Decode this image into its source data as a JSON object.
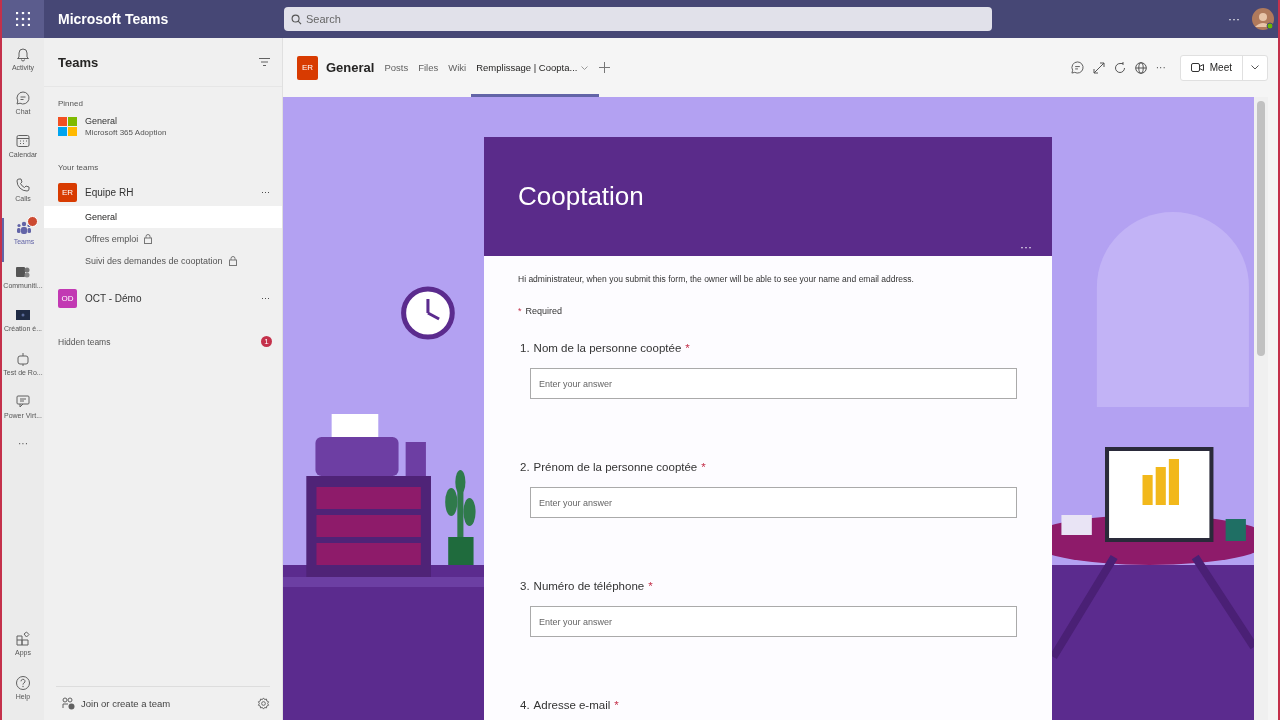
{
  "app_bar": {
    "title": "Microsoft Teams",
    "search_placeholder": "Search",
    "more": "···"
  },
  "rail": [
    {
      "label": "Activity",
      "selected": false,
      "badge": false
    },
    {
      "label": "Chat",
      "selected": false,
      "badge": false
    },
    {
      "label": "Calendar",
      "selected": false,
      "badge": false
    },
    {
      "label": "Calls",
      "selected": false,
      "badge": false
    },
    {
      "label": "Teams",
      "selected": true,
      "badge": true
    },
    {
      "label": "Communiti...",
      "selected": false,
      "badge": false
    },
    {
      "label": "Création é...",
      "selected": false,
      "badge": false
    },
    {
      "label": "Test de Ro...",
      "selected": false,
      "badge": false
    },
    {
      "label": "Power Virt...",
      "selected": false,
      "badge": false
    }
  ],
  "rail_more": "···",
  "rail_bottom": [
    {
      "label": "Apps"
    },
    {
      "label": "Help"
    }
  ],
  "sidebar": {
    "title": "Teams",
    "pinned_heading": "Pinned",
    "pinned": [
      {
        "name": "General",
        "team": "Microsoft 365 Adoption"
      }
    ],
    "teams_heading": "Your teams",
    "teams": [
      {
        "initials": "ER",
        "name": "Equipe RH",
        "color": "#d83b01",
        "more": "···",
        "channels": [
          {
            "name": "General",
            "selected": true,
            "private": false
          },
          {
            "name": "Offres emploi",
            "selected": false,
            "private": true
          },
          {
            "name": "Suivi des demandes de cooptation",
            "selected": false,
            "private": true
          }
        ]
      },
      {
        "initials": "OD",
        "name": "OCT - Démo",
        "color": "#c239b3",
        "more": "···"
      }
    ],
    "hidden_label": "Hidden teams",
    "hidden_count": "1",
    "footer": "Join or create a team"
  },
  "channel_header": {
    "initials": "ER",
    "name": "General",
    "tabs": [
      {
        "label": "Posts",
        "selected": false
      },
      {
        "label": "Files",
        "selected": false
      },
      {
        "label": "Wiki",
        "selected": false
      },
      {
        "label": "Remplissage | Coopta...",
        "selected": true
      }
    ],
    "more": "···",
    "meet": "Meet"
  },
  "form": {
    "title": "Cooptation",
    "menu": "···",
    "notice": "Hi administrateur, when you submit this form, the owner will be able to see your name and email address.",
    "required_mark": "*",
    "required_label": "Required",
    "questions": [
      {
        "number": "1.",
        "label": "Nom de la personne cooptée",
        "required": true,
        "placeholder": "Enter your answer"
      },
      {
        "number": "2.",
        "label": "Prénom de la personne cooptée",
        "required": true,
        "placeholder": "Enter your answer"
      },
      {
        "number": "3.",
        "label": "Numéro de téléphone",
        "required": true,
        "placeholder": "Enter your answer"
      },
      {
        "number": "4.",
        "label": "Adresse e-mail",
        "required": true
      }
    ]
  }
}
